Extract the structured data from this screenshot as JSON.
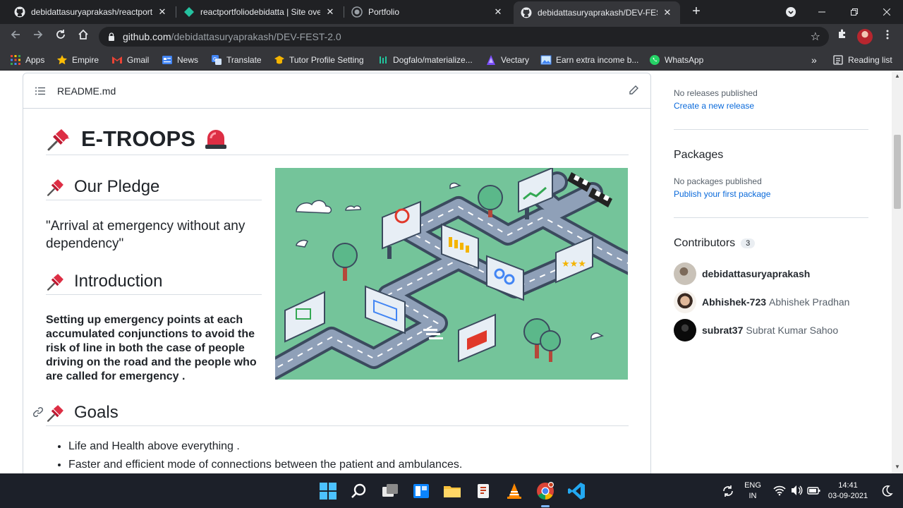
{
  "tabs": [
    {
      "title": "debidattasuryaprakash/reactportfolio",
      "close": "✕"
    },
    {
      "title": "reactportfoliodebidatta | Site overview",
      "close": "✕"
    },
    {
      "title": "Portfolio",
      "close": "✕"
    },
    {
      "title": "debidattasuryaprakash/DEV-FEST-2.0",
      "close": "✕"
    }
  ],
  "address": {
    "host": "github.com",
    "path": "/debidattasuryaprakash/DEV-FEST-2.0"
  },
  "bookmarks": [
    "Apps",
    "Empire",
    "Gmail",
    "News",
    "Translate",
    "Tutor Profile Setting",
    "Dogfalo/materialize...",
    "Vectary",
    "Earn extra income b...",
    "WhatsApp"
  ],
  "reading_list": "Reading list",
  "readme": {
    "filename": "README.md",
    "title": "E-TROOPS",
    "pledge_heading": "Our Pledge",
    "pledge_quote": "\"Arrival at emergency without any dependency\"",
    "intro_heading": "Introduction",
    "intro_text": "Setting up emergency points at each accumulated conjunctions to avoid the risk of line in both the case of people driving on the road and the people who are called for emergency .",
    "goals_heading": "Goals",
    "goals": [
      "Life and Health above everything .",
      "Faster and efficient mode of connections between the patient and ambulances."
    ]
  },
  "sidebar": {
    "releases_text": "No releases published",
    "releases_link": "Create a new release",
    "packages_heading": "Packages",
    "packages_text": "No packages published",
    "packages_link": "Publish your first package",
    "contributors_heading": "Contributors",
    "contributors_count": "3",
    "contributors": [
      {
        "login": "debidattasuryaprakash",
        "name": ""
      },
      {
        "login": "Abhishek-723",
        "name": "Abhishek Pradhan"
      },
      {
        "login": "subrat37",
        "name": "Subrat Kumar Sahoo"
      }
    ]
  },
  "taskbar": {
    "lang": "ENG",
    "region": "IN",
    "time": "14:41",
    "date": "03-09-2021"
  },
  "colors": {
    "accent_link": "#0969da",
    "pin_red": "#e0392b",
    "hero_bg": "#74c49a"
  }
}
